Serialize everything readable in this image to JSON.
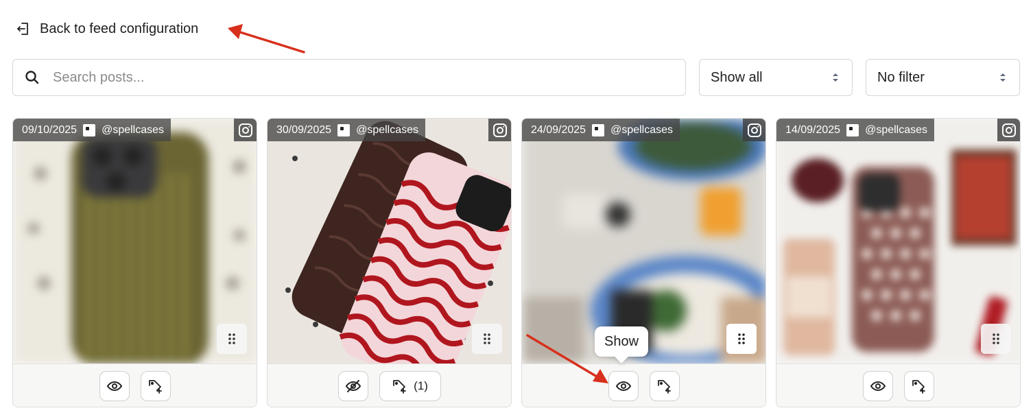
{
  "header": {
    "back_label": "Back to feed configuration"
  },
  "search": {
    "placeholder": "Search posts..."
  },
  "filters": {
    "show_value": "Show all",
    "filter_value": "No filter"
  },
  "posts": [
    {
      "date": "09/10/2025",
      "handle": "@spellcases",
      "visible": true,
      "tag_count": ""
    },
    {
      "date": "30/09/2025",
      "handle": "@spellcases",
      "visible": false,
      "tag_count": "(1)"
    },
    {
      "date": "24/09/2025",
      "handle": "@spellcases",
      "visible": true,
      "tag_count": ""
    },
    {
      "date": "14/09/2025",
      "handle": "@spellcases",
      "visible": true,
      "tag_count": ""
    }
  ],
  "tooltip": {
    "text": "Show"
  },
  "colors": {
    "annotation_arrow": "#d8301c",
    "accent_text": "#1f1f1f"
  }
}
